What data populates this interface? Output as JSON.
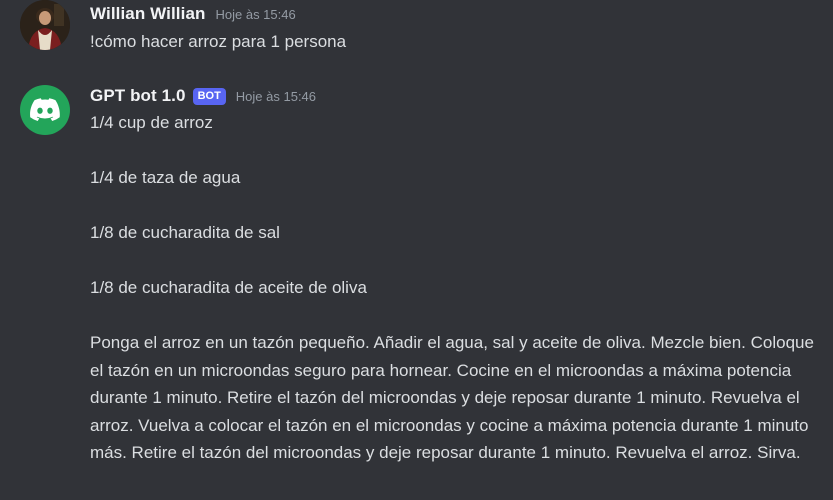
{
  "messages": [
    {
      "author": "Willian Willian",
      "timestamp": "Hoje às 15:46",
      "text": "!cómo hacer arroz para 1 persona"
    },
    {
      "author": "GPT bot 1.0",
      "badge": "BOT",
      "timestamp": "Hoje às 15:46",
      "lines": [
        "1/4 cup de arroz",
        "1/4 de taza de agua",
        "1/8 de cucharadita de sal",
        "1/8 de cucharadita de aceite de oliva",
        "Ponga el arroz en un tazón pequeño. Añadir el agua, sal y aceite de oliva. Mezcle bien. Coloque el tazón en un microondas seguro para hornear. Cocine en el microondas a máxima potencia durante 1 minuto. Retire el tazón del microondas y deje reposar durante 1 minuto. Revuelva el arroz. Vuelva a colocar el tazón en el microondas y cocine a máxima potencia durante 1 minuto más. Retire el tazón del microondas y deje reposar durante 1 minuto. Revuelva el arroz. Sirva."
      ]
    }
  ],
  "colors": {
    "background": "#313338",
    "text": "#dbdee1",
    "author": "#f2f3f5",
    "timestamp": "#949ba4",
    "bot_badge": "#5865f2",
    "bot_avatar": "#23a55a"
  },
  "icons": {
    "user_avatar": "portrait-painting-avatar",
    "bot_avatar": "discord-logo-icon"
  }
}
